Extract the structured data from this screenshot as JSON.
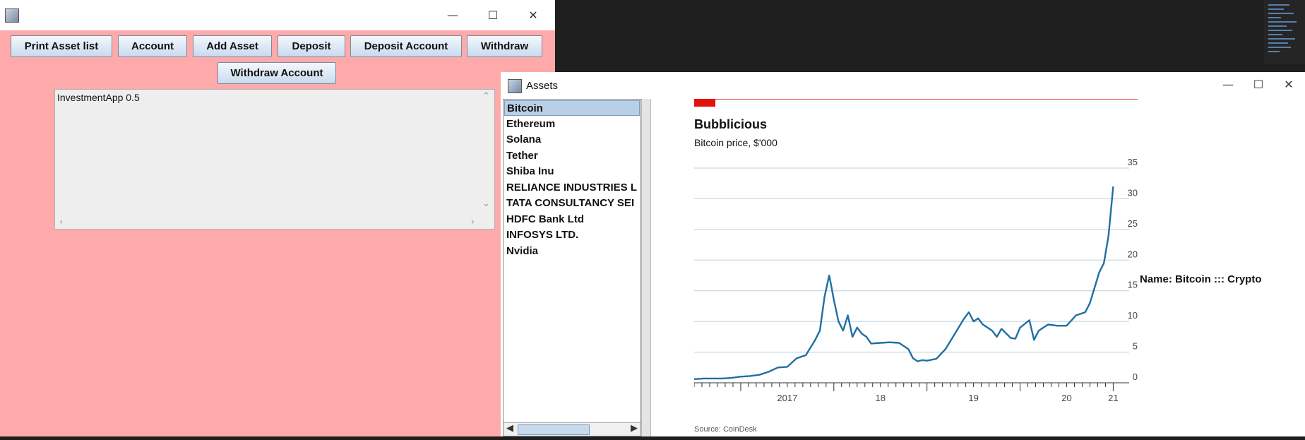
{
  "main_window": {
    "toolbar": {
      "print_asset_list": "Print Asset list",
      "account": "Account",
      "add_asset": "Add Asset",
      "deposit": "Deposit",
      "deposit_account": "Deposit Account",
      "withdraw": "Withdraw",
      "withdraw_account": "Withdraw Account"
    },
    "output_text": "InvestmentApp 0.5"
  },
  "assets_window": {
    "title": "Assets",
    "assets": [
      "Bitcoin",
      "Ethereum",
      "Solana",
      "Tether",
      "Shiba Inu",
      "RELIANCE INDUSTRIES L",
      "TATA CONSULTANCY SEI",
      "HDFC Bank Ltd",
      "INFOSYS LTD.",
      "Nvidia"
    ],
    "selected_index": 0,
    "detail_label": "Name: Bitcoin ::: Crypto"
  },
  "chart_data": {
    "type": "line",
    "title": "Bubblicious",
    "subtitle": "Bitcoin price, $'000",
    "source": "Source: CoinDesk",
    "x_tick_labels": [
      "2017",
      "18",
      "19",
      "20",
      "21"
    ],
    "y_tick_labels": [
      "35",
      "30",
      "25",
      "20",
      "15",
      "10",
      "5",
      "0"
    ],
    "ylim": [
      0,
      35
    ],
    "xlim": [
      2016.5,
      2021.05
    ],
    "grid": true,
    "colors": {
      "line": "#1f6fa3",
      "accent": "#e3120b"
    },
    "series": [
      {
        "x": [
          2016.5,
          2016.6,
          2016.7,
          2016.8,
          2016.9,
          2017.0,
          2017.1,
          2017.2,
          2017.3,
          2017.4,
          2017.5,
          2017.6,
          2017.7,
          2017.8,
          2017.85,
          2017.9,
          2017.95,
          2017.97,
          2018.0,
          2018.05,
          2018.1,
          2018.15,
          2018.2,
          2018.25,
          2018.3,
          2018.35,
          2018.4,
          2018.5,
          2018.6,
          2018.7,
          2018.8,
          2018.85,
          2018.9,
          2018.95,
          2019.0,
          2019.1,
          2019.2,
          2019.3,
          2019.4,
          2019.45,
          2019.5,
          2019.55,
          2019.6,
          2019.7,
          2019.75,
          2019.8,
          2019.9,
          2019.95,
          2020.0,
          2020.1,
          2020.15,
          2020.2,
          2020.3,
          2020.4,
          2020.5,
          2020.6,
          2020.7,
          2020.75,
          2020.8,
          2020.85,
          2020.9,
          2020.95,
          2021.0
        ],
        "y": [
          0.6,
          0.7,
          0.7,
          0.7,
          0.8,
          1.0,
          1.1,
          1.3,
          1.8,
          2.5,
          2.6,
          4.0,
          4.5,
          7.0,
          8.5,
          14.0,
          17.5,
          16.0,
          13.5,
          10.0,
          8.5,
          11.0,
          7.5,
          9.0,
          8.0,
          7.5,
          6.4,
          6.5,
          6.6,
          6.5,
          5.5,
          4.0,
          3.5,
          3.7,
          3.6,
          3.9,
          5.5,
          8.0,
          10.5,
          11.5,
          10.0,
          10.5,
          9.5,
          8.5,
          7.5,
          8.8,
          7.3,
          7.2,
          9.0,
          10.2,
          7.0,
          8.5,
          9.5,
          9.3,
          9.3,
          11.0,
          11.5,
          13.0,
          15.5,
          18.0,
          19.5,
          24.0,
          32.0
        ]
      }
    ]
  }
}
